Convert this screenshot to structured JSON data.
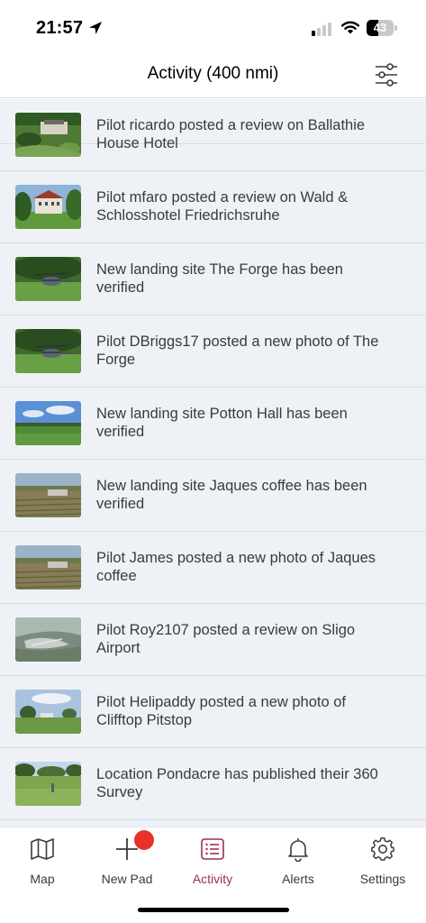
{
  "status_bar": {
    "time": "21:57",
    "battery_percent": "43",
    "battery_level": 0.43,
    "signal_bars_active": 1
  },
  "header": {
    "title": "Activity (400 nmi)",
    "filter_icon": "sliders-icon"
  },
  "colors": {
    "accent": "#9b2f57",
    "badge": "#e8312b",
    "feed_background": "#eef2f6",
    "divider": "#d8dde3"
  },
  "feed": [
    {
      "text": "Pilot ricardo posted a review on Ballathie House Hotel",
      "thumb": "hotel-grounds-aerial"
    },
    {
      "text": "Pilot mfaro posted a review on Wald & Schlosshotel Friedrichsruhe",
      "thumb": "castle-hotel-lawn"
    },
    {
      "text": "New landing site The Forge has been verified",
      "thumb": "helicopter-on-grass"
    },
    {
      "text": "Pilot DBriggs17 posted a new photo of The Forge",
      "thumb": "helicopter-on-grass"
    },
    {
      "text": "New landing site Potton Hall has been verified",
      "thumb": "open-field-blue-sky"
    },
    {
      "text": "New landing site Jaques coffee has been verified",
      "thumb": "farm-aerial"
    },
    {
      "text": "Pilot James posted a new photo of Jaques coffee",
      "thumb": "farm-aerial"
    },
    {
      "text": "Pilot Roy2107 posted a review on Sligo Airport",
      "thumb": "coastal-airport-aerial"
    },
    {
      "text": "Pilot Helipaddy posted a new photo of Clifftop Pitstop",
      "thumb": "clifftop-field"
    },
    {
      "text": "Location Pondacre has published their 360 Survey",
      "thumb": "grass-field-trees"
    }
  ],
  "tabs": [
    {
      "label": "Map",
      "icon": "map-icon",
      "active": false
    },
    {
      "label": "New Pad",
      "icon": "plus-icon",
      "active": false,
      "has_badge": true
    },
    {
      "label": "Activity",
      "icon": "list-icon",
      "active": true
    },
    {
      "label": "Alerts",
      "icon": "bell-icon",
      "active": false
    },
    {
      "label": "Settings",
      "icon": "gear-icon",
      "active": false
    }
  ]
}
